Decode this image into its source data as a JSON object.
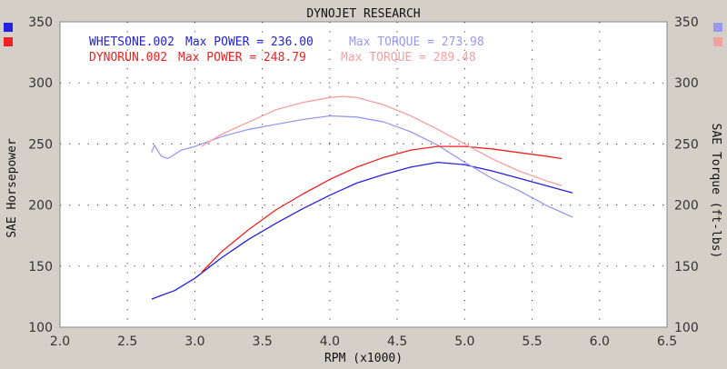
{
  "chart_data": {
    "type": "line",
    "title": "DYNOJET RESEARCH",
    "xlabel": "RPM (x1000)",
    "ylabel_left": "SAE Horsepower",
    "ylabel_right": "SAE Torque (ft-lbs)",
    "xlim": [
      2.0,
      6.5
    ],
    "ylim": [
      100,
      350
    ],
    "xticks": [
      "2.0",
      "2.5",
      "3.0",
      "3.5",
      "4.0",
      "4.5",
      "5.0",
      "5.5",
      "6.0",
      "6.5"
    ],
    "yticks": [
      "100",
      "150",
      "200",
      "250",
      "300",
      "350"
    ],
    "grid": true,
    "legend": [
      {
        "run": "WHETSONE.002",
        "power_label": "Max POWER = 236.00",
        "torque_label": "Max TORQUE = 273.98",
        "power_color": "#2222dd",
        "torque_color": "#9999ee"
      },
      {
        "run": "DYNORUN.002",
        "power_label": "Max POWER = 248.79",
        "torque_label": "Max TORQUE = 289.48",
        "power_color": "#ee2222",
        "torque_color": "#f4a0a0"
      }
    ],
    "series": [
      {
        "name": "WHETSONE.002 Max POWER",
        "color": "#2222dd",
        "x": [
          2.68,
          2.75,
          2.85,
          3.0,
          3.2,
          3.4,
          3.6,
          3.8,
          4.0,
          4.2,
          4.4,
          4.6,
          4.8,
          5.0,
          5.2,
          5.4,
          5.6,
          5.8
        ],
        "y": [
          123,
          126,
          130,
          140,
          157,
          172,
          185,
          197,
          208,
          218,
          225,
          231,
          235,
          233,
          228,
          222,
          216,
          210
        ]
      },
      {
        "name": "WHETSONE.002 Max TORQUE",
        "color": "#9999ee",
        "x": [
          2.68,
          2.7,
          2.75,
          2.8,
          2.9,
          3.0,
          3.2,
          3.4,
          3.6,
          3.8,
          4.0,
          4.2,
          4.4,
          4.6,
          4.8,
          5.0,
          5.2,
          5.4,
          5.6,
          5.8
        ],
        "y": [
          243,
          249,
          240,
          238,
          245,
          248,
          256,
          262,
          266,
          270,
          273,
          272,
          268,
          260,
          249,
          235,
          222,
          212,
          200,
          190
        ]
      },
      {
        "name": "DYNORUN.002 Max POWER",
        "color": "#ee2222",
        "x": [
          3.05,
          3.2,
          3.4,
          3.6,
          3.8,
          4.0,
          4.2,
          4.4,
          4.6,
          4.8,
          5.0,
          5.2,
          5.4,
          5.6,
          5.72
        ],
        "y": [
          145,
          162,
          180,
          196,
          209,
          221,
          231,
          239,
          245,
          248,
          248,
          246,
          243,
          240,
          238
        ]
      },
      {
        "name": "DYNORUN.002 Max TORQUE",
        "color": "#f4a0a0",
        "x": [
          3.05,
          3.2,
          3.4,
          3.6,
          3.8,
          4.0,
          4.1,
          4.2,
          4.4,
          4.6,
          4.8,
          5.0,
          5.2,
          5.4,
          5.6,
          5.72
        ],
        "y": [
          248,
          258,
          268,
          278,
          284,
          288,
          289,
          288,
          282,
          273,
          262,
          250,
          238,
          228,
          220,
          216
        ]
      }
    ]
  }
}
